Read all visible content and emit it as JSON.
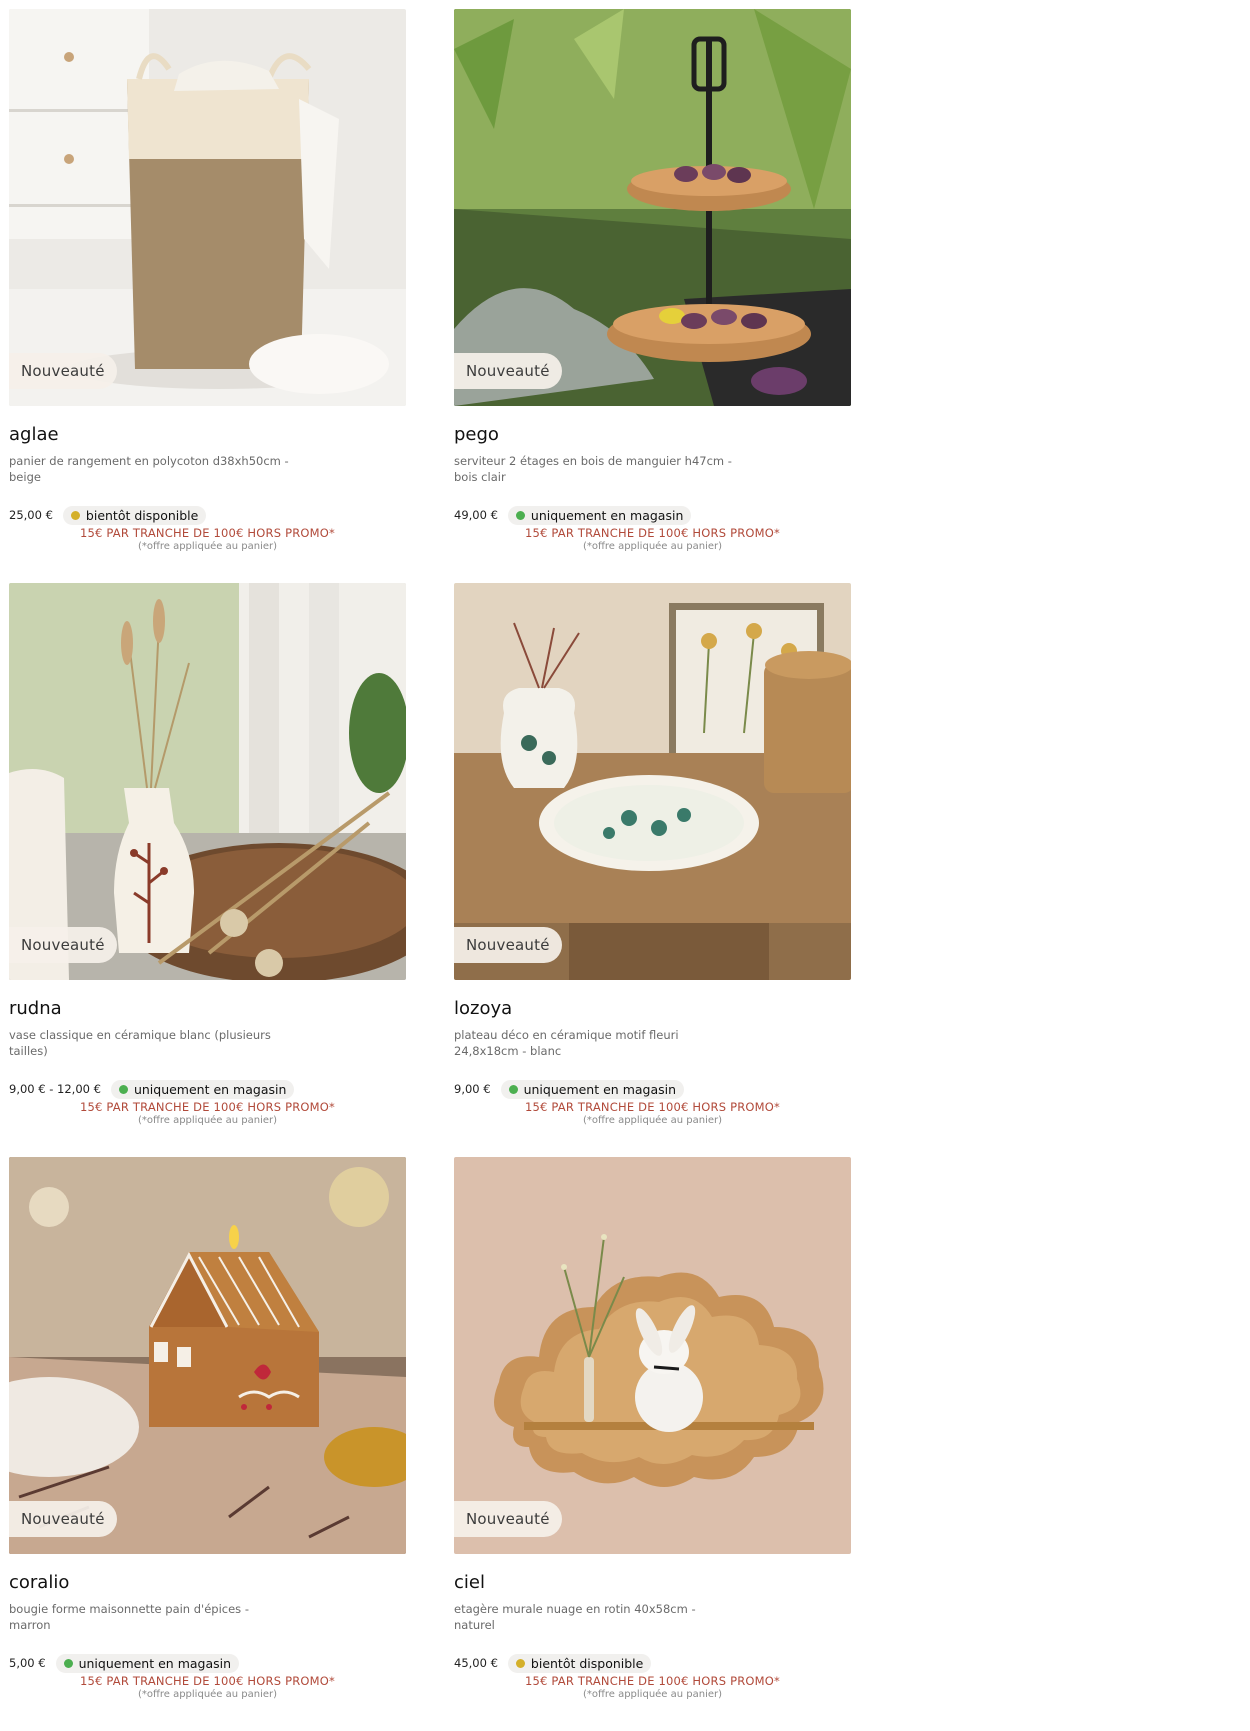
{
  "colors": {
    "promo": "#b14a3a",
    "available_green": "#4caf50",
    "soon_yellow": "#d4b02a",
    "badge_bg": "#f5f0e9"
  },
  "products": [
    {
      "badge": "Nouveauté",
      "name": "aglae",
      "desc": "panier de rangement en polycoton d38xh50cm - beige",
      "price": "25,00 €",
      "availability": "bientôt disponible",
      "status": "soon",
      "promo": "15€ PAR TRANCHE DE 100€ HORS PROMO*",
      "offer": "(*offre appliquée au panier)"
    },
    {
      "badge": "Nouveauté",
      "name": "pego",
      "desc": "serviteur 2 étages en bois de manguier h47cm - bois clair",
      "price": "49,00 €",
      "availability": "uniquement en magasin",
      "status": "store",
      "promo": "15€ PAR TRANCHE DE 100€ HORS PROMO*",
      "offer": "(*offre appliquée au panier)"
    },
    {
      "badge": "Nouveauté",
      "name": "rudna",
      "desc": "vase classique en céramique blanc (plusieurs tailles)",
      "price": "9,00 € - 12,00 €",
      "availability": "uniquement en magasin",
      "status": "store",
      "promo": "15€ PAR TRANCHE DE 100€ HORS PROMO*",
      "offer": "(*offre appliquée au panier)"
    },
    {
      "badge": "Nouveauté",
      "name": "lozoya",
      "desc": "plateau déco en céramique motif fleuri 24,8x18cm - blanc",
      "price": "9,00 €",
      "availability": "uniquement en magasin",
      "status": "store",
      "promo": "15€ PAR TRANCHE DE 100€ HORS PROMO*",
      "offer": "(*offre appliquée au panier)"
    },
    {
      "badge": "Nouveauté",
      "name": "coralio",
      "desc": "bougie forme maisonnette pain d'épices - marron",
      "price": "5,00 €",
      "availability": "uniquement en magasin",
      "status": "store",
      "promo": "15€ PAR TRANCHE DE 100€ HORS PROMO*",
      "offer": "(*offre appliquée au panier)"
    },
    {
      "badge": "Nouveauté",
      "name": "ciel",
      "desc": "etagère murale nuage en rotin 40x58cm - naturel",
      "price": "45,00 €",
      "availability": "bientôt disponible",
      "status": "soon",
      "promo": "15€ PAR TRANCHE DE 100€ HORS PROMO*",
      "offer": "(*offre appliquée au panier)"
    }
  ]
}
